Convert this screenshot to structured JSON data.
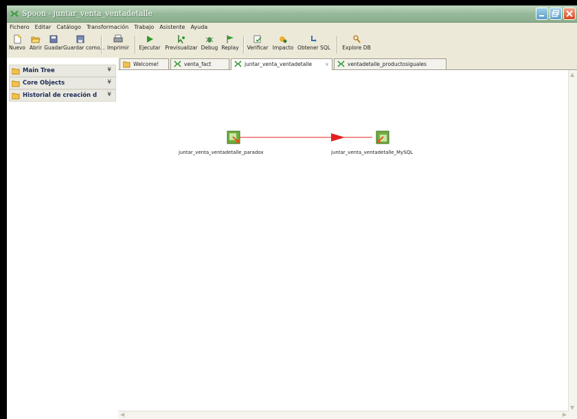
{
  "window": {
    "title": "Spoon - juntar_venta_ventadetalle"
  },
  "menu": [
    "Fichero",
    "Editar",
    "Catálogo",
    "Transformación",
    "Trabajo",
    "Asistente",
    "Ayuda"
  ],
  "toolbar": {
    "nuevo": "Nuevo",
    "abrir": "Abrir",
    "guardar": "Guadar",
    "guardar_como": "Guardar como...",
    "imprimir": "Imprimir",
    "ejecutar": "Ejecutar",
    "previsualizar": "Previsualizar",
    "debug": "Debug",
    "replay": "Replay",
    "verificar": "Verificar",
    "impacto": "Impacto",
    "obtener_sql": "Obtener SQL",
    "explore_db": "Explore DB"
  },
  "sidebar": {
    "panels": [
      {
        "label": "Main Tree",
        "chevron": "¥"
      },
      {
        "label": "Core Objects",
        "chevron": "¥"
      },
      {
        "label": "Historial de creación d",
        "chevron": "¥"
      }
    ]
  },
  "tabs": [
    {
      "label": "Welcome!"
    },
    {
      "label": "venta_fact"
    },
    {
      "label": "juntar_venta_ventadetalle",
      "close": "⨯"
    },
    {
      "label": "ventadetalle_productosiguales"
    }
  ],
  "canvas": {
    "steps": [
      {
        "name": "juntar_venta_ventadetalle_paradox",
        "role": "input"
      },
      {
        "name": "juntar_venta_ventadetalle_MySQL",
        "role": "output"
      }
    ],
    "hop_color": "#e51e1e"
  },
  "colors": {
    "titlebar": "#97b99a",
    "accent": "#1b2a55"
  }
}
